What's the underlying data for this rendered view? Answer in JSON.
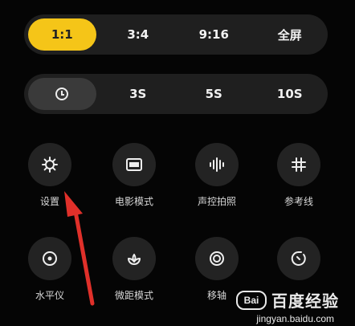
{
  "ratio_options": [
    "1:1",
    "3:4",
    "9:16",
    "全屏"
  ],
  "timer_options": [
    "3S",
    "5S",
    "10S"
  ],
  "tools": [
    {
      "label": "设置",
      "icon": "gear-icon"
    },
    {
      "label": "电影模式",
      "icon": "movie-icon"
    },
    {
      "label": "声控拍照",
      "icon": "soundwave-icon"
    },
    {
      "label": "参考线",
      "icon": "grid-icon"
    },
    {
      "label": "水平仪",
      "icon": "level-icon"
    },
    {
      "label": "微距模式",
      "icon": "macro-icon"
    },
    {
      "label": "移轴",
      "icon": "tiltshift-icon"
    },
    {
      "label": "",
      "icon": "timer-icon"
    }
  ],
  "watermark": {
    "logo_text": "Bai",
    "title": "百度经验",
    "url": "jingyan.baidu.com"
  },
  "colors": {
    "accent": "#f5c518",
    "background": "#050505",
    "arrow": "#e0302a"
  }
}
